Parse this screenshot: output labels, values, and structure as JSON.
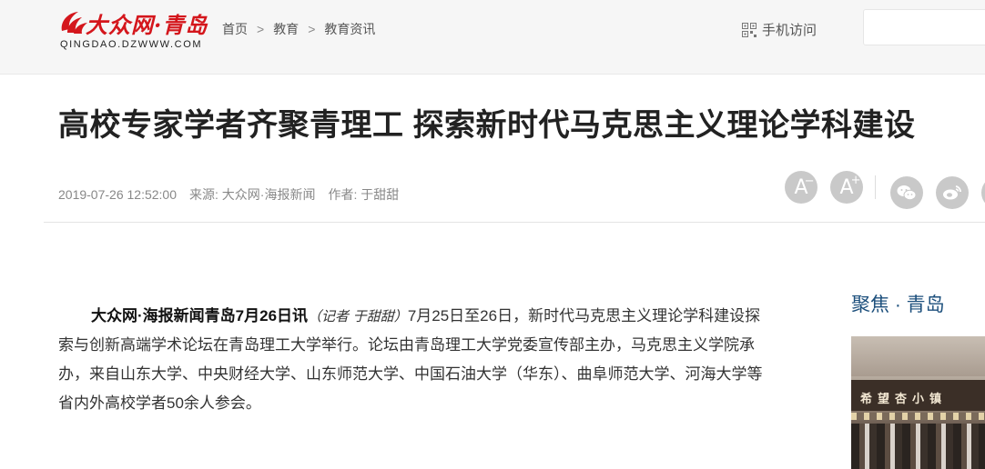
{
  "header": {
    "logo": {
      "brand": "大众网·青岛",
      "domain": "QINGDAO.DZWWW.COM"
    },
    "breadcrumb": [
      "首页",
      "教育",
      "教育资讯"
    ],
    "breadcrumb_separator": ">",
    "mobile_link": "手机访问"
  },
  "article": {
    "title": "高校专家学者齐聚青理工 探索新时代马克思主义理论学科建设",
    "date": "2019-07-26 12:52:00",
    "source": "来源: 大众网·海报新闻",
    "author": "作者: 于甜甜",
    "font_decrease_glyph": "A",
    "font_increase_glyph": "A",
    "lead": "大众网·海报新闻青岛7月26日讯",
    "reporter_note": "（记者 于甜甜）",
    "body": "7月25日至26日，新时代马克思主义理论学科建设探索与创新高端学术论坛在青岛理工大学举行。论坛由青岛理工大学党委宣传部主办，马克思主义学院承办，来自山东大学、中央财经大学、山东师范大学、中国石油大学（华东）、曲阜师范大学、河海大学等省内外高校学者50余人参会。"
  },
  "sidebar": {
    "title": "聚焦 · 青岛",
    "photo_sign": "希望杏小镇"
  },
  "colors": {
    "brand_red": "#d4161c",
    "sidebar_title": "#1c4f7c",
    "tool_button": "#c9c9c9"
  },
  "icons": [
    "logo-mark-icon",
    "qr-code-icon",
    "font-decrease-icon",
    "font-increase-icon",
    "wechat-icon",
    "weibo-icon"
  ]
}
